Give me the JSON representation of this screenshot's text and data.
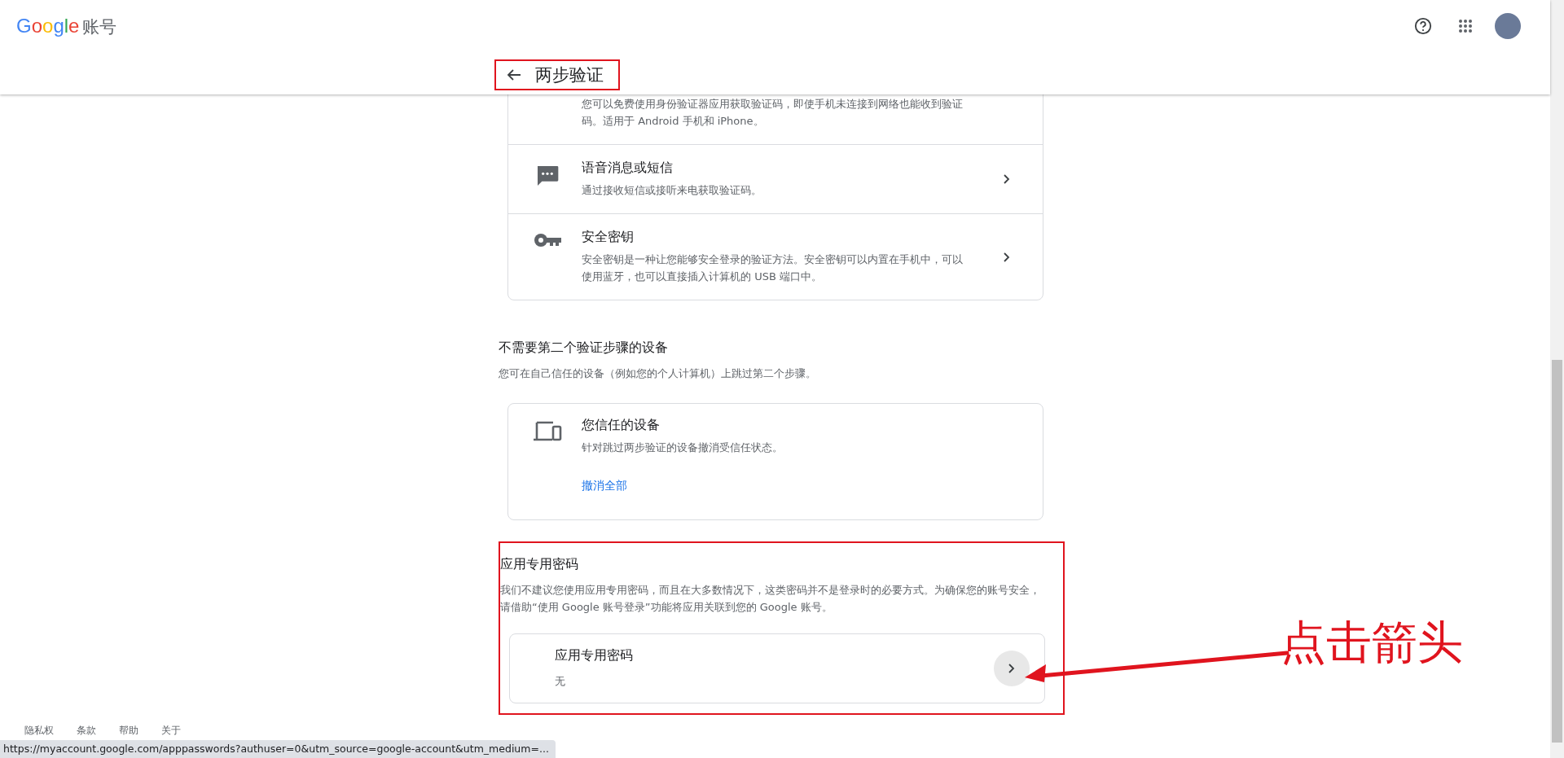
{
  "header": {
    "logo": {
      "brand": "Google",
      "product": "账号"
    },
    "page_title": "两步验证"
  },
  "methods_card": {
    "items": [
      {
        "kind": "authenticator",
        "description": "您可以免费使用身份验证器应用获取验证码，即使手机未连接到网络也能收到验证码。适用于 Android 手机和 iPhone。"
      },
      {
        "kind": "message",
        "title": "语音消息或短信",
        "description": "通过接收短信或接听来电获取验证码。"
      },
      {
        "kind": "key",
        "title": "安全密钥",
        "description": "安全密钥是一种让您能够安全登录的验证方法。安全密钥可以内置在手机中，可以使用蓝牙，也可以直接插入计算机的 USB 端口中。"
      }
    ]
  },
  "trusted_devices": {
    "heading": "不需要第二个验证步骤的设备",
    "description": "您可在自己信任的设备（例如您的个人计算机）上跳过第二个步骤。",
    "card": {
      "title": "您信任的设备",
      "description": "针对跳过两步验证的设备撤消受信任状态。",
      "link": "撤消全部"
    }
  },
  "app_passwords": {
    "heading": "应用专用密码",
    "description": "我们不建议您使用应用专用密码，而且在大多数情况下，这类密码并不是登录时的必要方式。为确保您的账号安全，请借助“使用 Google 账号登录”功能将应用关联到您的 Google 账号。",
    "card": {
      "title": "应用专用密码",
      "value": "无"
    }
  },
  "annotation": {
    "label": "点击箭头"
  },
  "footer": {
    "links": [
      "隐私权",
      "条款",
      "帮助",
      "关于"
    ]
  },
  "status_bar": {
    "url": "https://myaccount.google.com/apppasswords?authuser=0&utm_source=google-account&utm_medium=..."
  }
}
